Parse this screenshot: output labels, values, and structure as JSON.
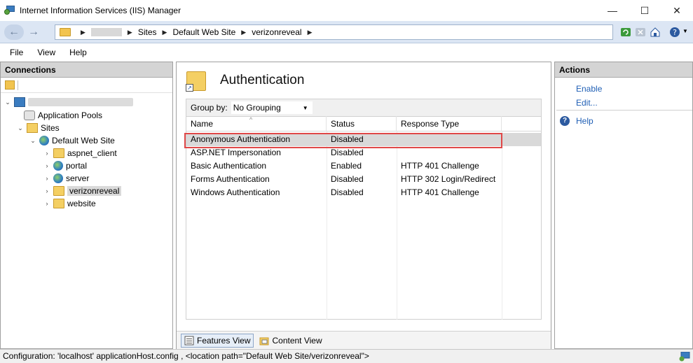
{
  "window": {
    "title": "Internet Information Services (IIS) Manager",
    "minimize": "—",
    "maximize": "☐",
    "close": "✕"
  },
  "address": {
    "segments": [
      "Sites",
      "Default Web Site",
      "verizonreveal"
    ],
    "back_label": "←",
    "forward_label": "→"
  },
  "menu": [
    "File",
    "View",
    "Help"
  ],
  "connections": {
    "header": "Connections",
    "tree": {
      "app_pools": "Application Pools",
      "sites": "Sites",
      "default_site": "Default Web Site",
      "children": [
        "aspnet_client",
        "portal",
        "server",
        "verizonreveal",
        "website"
      ],
      "selected": "verizonreveal"
    }
  },
  "feature": {
    "title": "Authentication",
    "group_by_label": "Group by:",
    "group_by_value": "No Grouping",
    "columns": [
      "Name",
      "Status",
      "Response Type"
    ],
    "rows": [
      {
        "name": "Anonymous Authentication",
        "status": "Disabled",
        "response": ""
      },
      {
        "name": "ASP.NET Impersonation",
        "status": "Disabled",
        "response": ""
      },
      {
        "name": "Basic Authentication",
        "status": "Enabled",
        "response": "HTTP 401 Challenge"
      },
      {
        "name": "Forms Authentication",
        "status": "Disabled",
        "response": "HTTP 302 Login/Redirect"
      },
      {
        "name": "Windows Authentication",
        "status": "Disabled",
        "response": "HTTP 401 Challenge"
      }
    ],
    "selected_row": 0,
    "tabs": [
      "Features View",
      "Content View"
    ]
  },
  "actions": {
    "header": "Actions",
    "enable": "Enable",
    "edit": "Edit...",
    "help": "Help"
  },
  "status": {
    "text": "Configuration: 'localhost' applicationHost.config , <location path=\"Default Web Site/verizonreveal\">"
  },
  "colors": {
    "highlight_box": "#e04848",
    "link": "#1f5fb5",
    "addressbar_bg": "#dce6f4"
  }
}
